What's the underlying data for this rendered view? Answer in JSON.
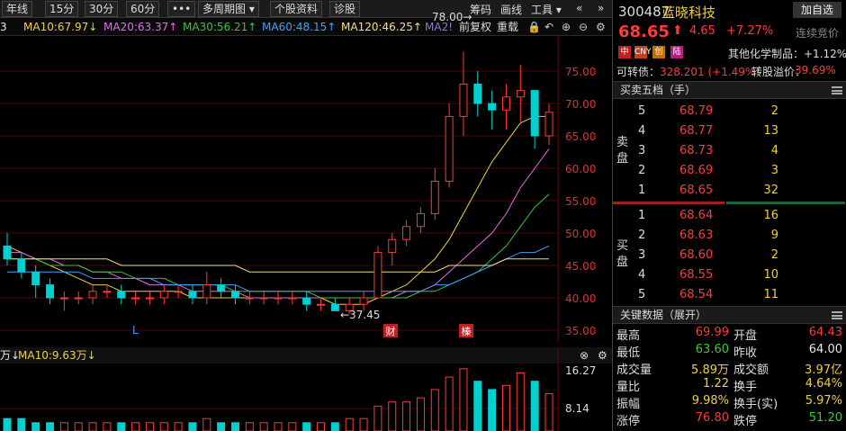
{
  "toolbar": {
    "periods": [
      "年线",
      "15分",
      "30分",
      "60分",
      "•••",
      "多周期图 ▾",
      "个股资料",
      "诊股"
    ],
    "tools": [
      "筹码",
      "画线",
      "工具 ▾"
    ]
  },
  "ma_bar": {
    "items": [
      {
        "text": "3",
        "color": "#e8e8e8"
      },
      {
        "text": "MA10:67.97↓",
        "color": "#f0d040"
      },
      {
        "text": "MA20:63.37↑",
        "color": "#e070e0"
      },
      {
        "text": "MA30:56.21↑",
        "color": "#40c040"
      },
      {
        "text": "MA60:48.15↑",
        "color": "#40a0ff"
      },
      {
        "text": "MA120:46.25↑",
        "color": "#f0e080"
      },
      {
        "text": "MA2!",
        "color": "#8080c0"
      }
    ],
    "right_labels": [
      "前复权",
      "重载"
    ]
  },
  "chart": {
    "y_ticks": [
      "75.00",
      "70.00",
      "65.00",
      "60.00",
      "55.00",
      "50.00",
      "45.00",
      "40.00",
      "35.00"
    ],
    "high_label": "78.00→",
    "low_label": "←37.45",
    "marker_l": "L",
    "marker_cai": "财",
    "marker_rong": "榛"
  },
  "chart_data": {
    "type": "candlestick",
    "ylim": [
      35,
      78
    ],
    "ohlc": [
      [
        48,
        50,
        45,
        46
      ],
      [
        46,
        47,
        43,
        44
      ],
      [
        44,
        45,
        40,
        42
      ],
      [
        42,
        43,
        39,
        40
      ],
      [
        40,
        41,
        38,
        40
      ],
      [
        40,
        41,
        39,
        40
      ],
      [
        40,
        42,
        39,
        41
      ],
      [
        41,
        42,
        40,
        41
      ],
      [
        41,
        42,
        39,
        40
      ],
      [
        40,
        41,
        39,
        40
      ],
      [
        40,
        41,
        39,
        40
      ],
      [
        40,
        42,
        39,
        41
      ],
      [
        41,
        42,
        40,
        41
      ],
      [
        41,
        42,
        39,
        40
      ],
      [
        40,
        44,
        39,
        42
      ],
      [
        42,
        43,
        40,
        41
      ],
      [
        41,
        42,
        39,
        40
      ],
      [
        40,
        41,
        39,
        40
      ],
      [
        40,
        41,
        39,
        40
      ],
      [
        40,
        41,
        39,
        40
      ],
      [
        40,
        41,
        39,
        40
      ],
      [
        40,
        41,
        38,
        39
      ],
      [
        39,
        40,
        38,
        39
      ],
      [
        39,
        40,
        38,
        38
      ],
      [
        38,
        40,
        37.45,
        39
      ],
      [
        39,
        41,
        38,
        40
      ],
      [
        40,
        48,
        40,
        47
      ],
      [
        47,
        50,
        45,
        49
      ],
      [
        49,
        52,
        48,
        51
      ],
      [
        51,
        54,
        50,
        53
      ],
      [
        53,
        60,
        52,
        58
      ],
      [
        58,
        70,
        57,
        68
      ],
      [
        68,
        78,
        65,
        73
      ],
      [
        73,
        75,
        68,
        70
      ],
      [
        70,
        72,
        66,
        69
      ],
      [
        69,
        73,
        66,
        71
      ],
      [
        71,
        76,
        67,
        72
      ],
      [
        72,
        70,
        63,
        65
      ],
      [
        65,
        69.99,
        63.6,
        68.65
      ]
    ],
    "ma_series": [
      {
        "name": "MA10",
        "values": [
          48,
          47,
          46,
          45,
          44,
          43,
          42,
          42,
          41,
          41,
          41,
          41,
          41,
          40,
          40,
          40,
          40,
          40,
          40,
          40,
          40,
          40,
          40,
          39,
          39,
          39,
          40,
          41,
          42,
          44,
          46,
          49,
          53,
          57,
          61,
          64,
          67,
          68,
          68
        ]
      },
      {
        "name": "MA20",
        "values": [
          47,
          47,
          46,
          46,
          45,
          45,
          44,
          44,
          43,
          43,
          42,
          42,
          42,
          41,
          41,
          41,
          41,
          40,
          40,
          40,
          40,
          40,
          40,
          40,
          40,
          40,
          40,
          40,
          41,
          41,
          42,
          44,
          46,
          48,
          50,
          53,
          57,
          60,
          63
        ]
      },
      {
        "name": "MA30",
        "values": [
          46,
          46,
          46,
          45,
          45,
          45,
          44,
          44,
          44,
          43,
          43,
          43,
          42,
          42,
          42,
          42,
          41,
          41,
          41,
          41,
          41,
          41,
          40,
          40,
          40,
          40,
          40,
          40,
          40,
          41,
          41,
          42,
          43,
          44,
          46,
          48,
          51,
          54,
          56
        ]
      },
      {
        "name": "MA60",
        "values": [
          44,
          44,
          44,
          44,
          44,
          44,
          43,
          43,
          43,
          43,
          43,
          42,
          42,
          42,
          42,
          42,
          42,
          41,
          41,
          41,
          41,
          41,
          41,
          41,
          41,
          41,
          41,
          41,
          41,
          41,
          42,
          42,
          43,
          44,
          45,
          46,
          47,
          47,
          48
        ]
      },
      {
        "name": "MA120",
        "values": [
          46,
          46,
          46,
          46,
          46,
          46,
          46,
          46,
          45,
          45,
          45,
          45,
          45,
          45,
          45,
          45,
          45,
          44,
          44,
          44,
          44,
          44,
          44,
          44,
          44,
          44,
          44,
          44,
          44,
          44,
          44,
          45,
          45,
          45,
          45,
          46,
          46,
          46,
          46
        ]
      }
    ],
    "volume": [
      3,
      3,
      2,
      2,
      2,
      2,
      2,
      2,
      2,
      2,
      2,
      2,
      2,
      2,
      3,
      2,
      2,
      2,
      2,
      2,
      2,
      2,
      2,
      2,
      3,
      3,
      6,
      7,
      7,
      8,
      10,
      13,
      15,
      12,
      10,
      11,
      14,
      12,
      9
    ],
    "volume_ylim": [
      0,
      16.27
    ],
    "volume_ticks": [
      "16.27",
      "8.14"
    ]
  },
  "volume_bar": {
    "left": "万↓",
    "ma10": "MA10:9.63万↓"
  },
  "quote": {
    "code": "300487",
    "name": "蓝晓科技",
    "add_fav": "加自选",
    "price": "68.65",
    "arrow": "⬆",
    "change": "4.65",
    "pct": "+7.27%",
    "bid_label": "连续竞价",
    "tags": [
      "中",
      "CNY",
      "创",
      "陆"
    ],
    "sector": "其他化学制品：+1.12%",
    "conv_label": "可转债：",
    "conv_value": "328.201 (+1.49%)",
    "prem_label": "转股溢价：",
    "prem_value": "39.69%"
  },
  "orderbook": {
    "title": "买卖五档（手）",
    "sell_label": "卖盘",
    "buy_label": "买盘",
    "sells": [
      {
        "lvl": "5",
        "price": "68.79",
        "vol": "2"
      },
      {
        "lvl": "4",
        "price": "68.77",
        "vol": "13"
      },
      {
        "lvl": "3",
        "price": "68.73",
        "vol": "4"
      },
      {
        "lvl": "2",
        "price": "68.69",
        "vol": "3"
      },
      {
        "lvl": "1",
        "price": "68.65",
        "vol": "32"
      }
    ],
    "buys": [
      {
        "lvl": "1",
        "price": "68.64",
        "vol": "16"
      },
      {
        "lvl": "2",
        "price": "68.63",
        "vol": "9"
      },
      {
        "lvl": "3",
        "price": "68.60",
        "vol": "2"
      },
      {
        "lvl": "4",
        "price": "68.55",
        "vol": "10"
      },
      {
        "lvl": "5",
        "price": "68.54",
        "vol": "11"
      }
    ]
  },
  "keydata": {
    "title": "关键数据（展开）",
    "rows": [
      {
        "l1": "最高",
        "v1": "69.99",
        "c1": "#ff3a3a",
        "l2": "开盘",
        "v2": "64.43",
        "c2": "#ff3a3a"
      },
      {
        "l1": "最低",
        "v1": "63.60",
        "c1": "#30d030",
        "l2": "昨收",
        "v2": "64.00",
        "c2": "#e8e8e8"
      },
      {
        "l1": "成交量",
        "v1": "5.89万",
        "c1": "#f0d040",
        "l2": "成交额",
        "v2": "3.97亿",
        "c2": "#f0d040"
      },
      {
        "l1": "量比",
        "v1": "1.22",
        "c1": "#f0d040",
        "l2": "换手",
        "v2": "4.64%",
        "c2": "#f0d040"
      },
      {
        "l1": "振幅",
        "v1": "9.98%",
        "c1": "#f0d040",
        "l2": "换手(实)",
        "v2": "5.97%",
        "c2": "#f0d040"
      },
      {
        "l1": "涨停",
        "v1": "76.80",
        "c1": "#ff3a3a",
        "l2": "跌停",
        "v2": "51.20",
        "c2": "#30d030"
      }
    ]
  }
}
